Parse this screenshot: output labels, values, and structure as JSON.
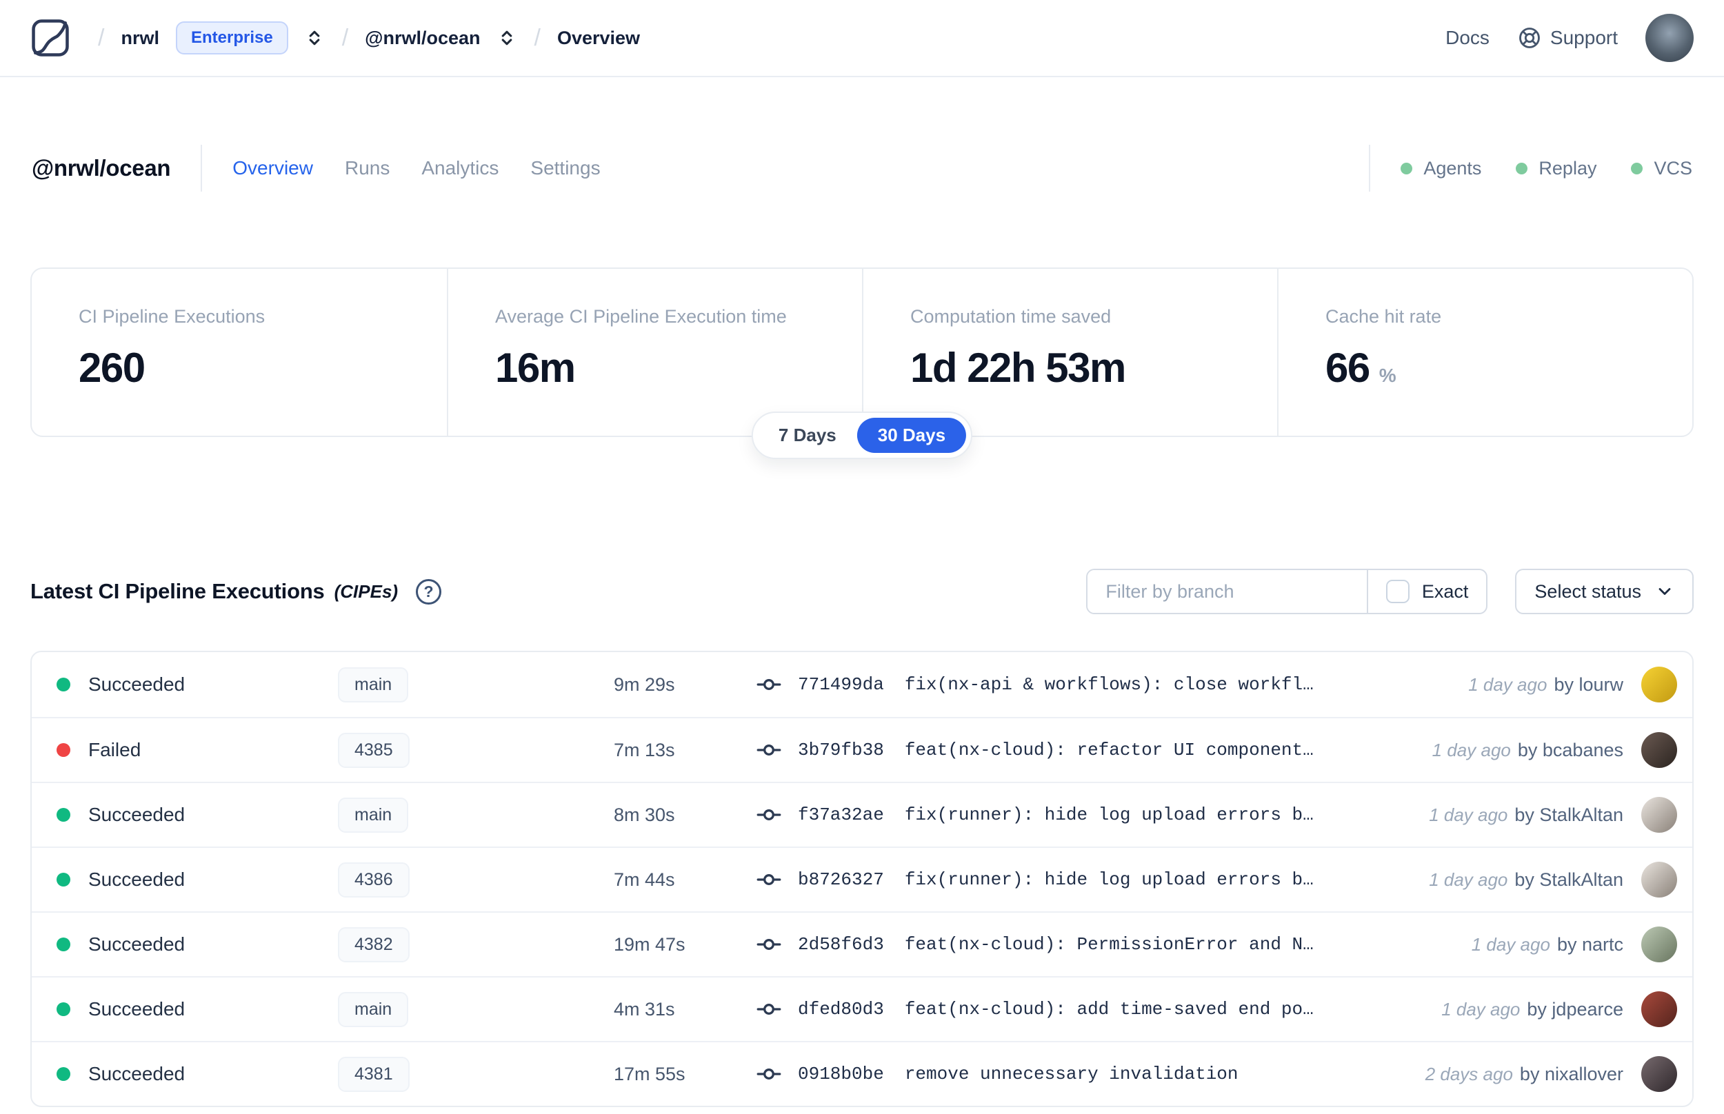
{
  "topbar": {
    "breadcrumb": {
      "separator": "/",
      "org": "nrwl",
      "org_badge": "Enterprise",
      "workspace": "@nrwl/ocean",
      "page": "Overview"
    },
    "docs_label": "Docs",
    "support_label": "Support"
  },
  "workspace": {
    "title": "@nrwl/ocean",
    "tabs": [
      "Overview",
      "Runs",
      "Analytics",
      "Settings"
    ],
    "active_tab": "Overview",
    "services": [
      "Agents",
      "Replay",
      "VCS"
    ]
  },
  "stats": {
    "cards": [
      {
        "label": "CI Pipeline Executions",
        "value": "260",
        "unit": ""
      },
      {
        "label": "Average CI Pipeline Execution time",
        "value": "16m",
        "unit": ""
      },
      {
        "label": "Computation time saved",
        "value": "1d 22h 53m",
        "unit": ""
      },
      {
        "label": "Cache hit rate",
        "value": "66",
        "unit": "%"
      }
    ]
  },
  "time_range": {
    "options": [
      "7 Days",
      "30 Days"
    ],
    "selected": "30 Days"
  },
  "section": {
    "title": "Latest CI Pipeline Executions",
    "subtitle": "(CIPEs)",
    "help_glyph": "?",
    "filter_placeholder": "Filter by branch",
    "filter_value": "",
    "exact_label": "Exact",
    "exact_checked": false,
    "status_dropdown_label": "Select status"
  },
  "table": {
    "by_prefix": "by",
    "rows": [
      {
        "status": "Succeeded",
        "status_color": "#10b981",
        "branch": "main",
        "duration": "9m 29s",
        "commit_hash": "771499da",
        "commit_message": "fix(nx-api & workflows): close workfl…",
        "time_ago": "1 day ago",
        "author": "lourw",
        "avatar_colors": [
          "#f6d234",
          "#c29a12"
        ]
      },
      {
        "status": "Failed",
        "status_color": "#ef4444",
        "branch": "4385",
        "duration": "7m 13s",
        "commit_hash": "3b79fb38",
        "commit_message": "feat(nx-cloud): refactor UI component…",
        "time_ago": "1 day ago",
        "author": "bcabanes",
        "avatar_colors": [
          "#6b5a52",
          "#2b2420"
        ]
      },
      {
        "status": "Succeeded",
        "status_color": "#10b981",
        "branch": "main",
        "duration": "8m 30s",
        "commit_hash": "f37a32ae",
        "commit_message": "fix(runner): hide log upload errors b…",
        "time_ago": "1 day ago",
        "author": "StalkAltan",
        "avatar_colors": [
          "#e9e4de",
          "#8a8179"
        ]
      },
      {
        "status": "Succeeded",
        "status_color": "#10b981",
        "branch": "4386",
        "duration": "7m 44s",
        "commit_hash": "b8726327",
        "commit_message": "fix(runner): hide log upload errors b…",
        "time_ago": "1 day ago",
        "author": "StalkAltan",
        "avatar_colors": [
          "#e9e4de",
          "#8a8179"
        ]
      },
      {
        "status": "Succeeded",
        "status_color": "#10b981",
        "branch": "4382",
        "duration": "19m 47s",
        "commit_hash": "2d58f6d3",
        "commit_message": "feat(nx-cloud): PermissionError and N…",
        "time_ago": "1 day ago",
        "author": "nartc",
        "avatar_colors": [
          "#bcc9b4",
          "#68755f"
        ]
      },
      {
        "status": "Succeeded",
        "status_color": "#10b981",
        "branch": "main",
        "duration": "4m 31s",
        "commit_hash": "dfed80d3",
        "commit_message": "feat(nx-cloud): add time-saved end po…",
        "time_ago": "1 day ago",
        "author": "jdpearce",
        "avatar_colors": [
          "#a8493c",
          "#55241d"
        ]
      },
      {
        "status": "Succeeded",
        "status_color": "#10b981",
        "branch": "4381",
        "duration": "17m 55s",
        "commit_hash": "0918b0be",
        "commit_message": "remove unnecessary invalidation",
        "time_ago": "2 days ago",
        "author": "nixallover",
        "avatar_colors": [
          "#776a6e",
          "#2f282c"
        ]
      }
    ]
  },
  "colors": {
    "accent_blue": "#2b62e9",
    "link_blue": "#2563eb",
    "succeeded_green": "#10b981",
    "failed_red": "#ef4444",
    "service_dot_green": "#7fcb9e"
  }
}
